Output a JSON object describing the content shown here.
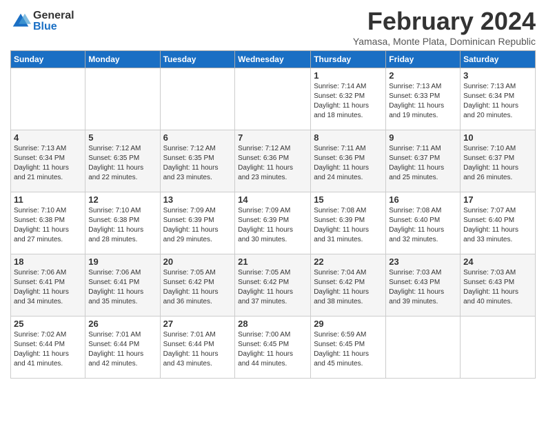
{
  "logo": {
    "general": "General",
    "blue": "Blue"
  },
  "title": "February 2024",
  "location": "Yamasa, Monte Plata, Dominican Republic",
  "days_header": [
    "Sunday",
    "Monday",
    "Tuesday",
    "Wednesday",
    "Thursday",
    "Friday",
    "Saturday"
  ],
  "weeks": [
    [
      {
        "day": "",
        "info": ""
      },
      {
        "day": "",
        "info": ""
      },
      {
        "day": "",
        "info": ""
      },
      {
        "day": "",
        "info": ""
      },
      {
        "day": "1",
        "info": "Sunrise: 7:14 AM\nSunset: 6:32 PM\nDaylight: 11 hours\nand 18 minutes."
      },
      {
        "day": "2",
        "info": "Sunrise: 7:13 AM\nSunset: 6:33 PM\nDaylight: 11 hours\nand 19 minutes."
      },
      {
        "day": "3",
        "info": "Sunrise: 7:13 AM\nSunset: 6:34 PM\nDaylight: 11 hours\nand 20 minutes."
      }
    ],
    [
      {
        "day": "4",
        "info": "Sunrise: 7:13 AM\nSunset: 6:34 PM\nDaylight: 11 hours\nand 21 minutes."
      },
      {
        "day": "5",
        "info": "Sunrise: 7:12 AM\nSunset: 6:35 PM\nDaylight: 11 hours\nand 22 minutes."
      },
      {
        "day": "6",
        "info": "Sunrise: 7:12 AM\nSunset: 6:35 PM\nDaylight: 11 hours\nand 23 minutes."
      },
      {
        "day": "7",
        "info": "Sunrise: 7:12 AM\nSunset: 6:36 PM\nDaylight: 11 hours\nand 23 minutes."
      },
      {
        "day": "8",
        "info": "Sunrise: 7:11 AM\nSunset: 6:36 PM\nDaylight: 11 hours\nand 24 minutes."
      },
      {
        "day": "9",
        "info": "Sunrise: 7:11 AM\nSunset: 6:37 PM\nDaylight: 11 hours\nand 25 minutes."
      },
      {
        "day": "10",
        "info": "Sunrise: 7:10 AM\nSunset: 6:37 PM\nDaylight: 11 hours\nand 26 minutes."
      }
    ],
    [
      {
        "day": "11",
        "info": "Sunrise: 7:10 AM\nSunset: 6:38 PM\nDaylight: 11 hours\nand 27 minutes."
      },
      {
        "day": "12",
        "info": "Sunrise: 7:10 AM\nSunset: 6:38 PM\nDaylight: 11 hours\nand 28 minutes."
      },
      {
        "day": "13",
        "info": "Sunrise: 7:09 AM\nSunset: 6:39 PM\nDaylight: 11 hours\nand 29 minutes."
      },
      {
        "day": "14",
        "info": "Sunrise: 7:09 AM\nSunset: 6:39 PM\nDaylight: 11 hours\nand 30 minutes."
      },
      {
        "day": "15",
        "info": "Sunrise: 7:08 AM\nSunset: 6:39 PM\nDaylight: 11 hours\nand 31 minutes."
      },
      {
        "day": "16",
        "info": "Sunrise: 7:08 AM\nSunset: 6:40 PM\nDaylight: 11 hours\nand 32 minutes."
      },
      {
        "day": "17",
        "info": "Sunrise: 7:07 AM\nSunset: 6:40 PM\nDaylight: 11 hours\nand 33 minutes."
      }
    ],
    [
      {
        "day": "18",
        "info": "Sunrise: 7:06 AM\nSunset: 6:41 PM\nDaylight: 11 hours\nand 34 minutes."
      },
      {
        "day": "19",
        "info": "Sunrise: 7:06 AM\nSunset: 6:41 PM\nDaylight: 11 hours\nand 35 minutes."
      },
      {
        "day": "20",
        "info": "Sunrise: 7:05 AM\nSunset: 6:42 PM\nDaylight: 11 hours\nand 36 minutes."
      },
      {
        "day": "21",
        "info": "Sunrise: 7:05 AM\nSunset: 6:42 PM\nDaylight: 11 hours\nand 37 minutes."
      },
      {
        "day": "22",
        "info": "Sunrise: 7:04 AM\nSunset: 6:42 PM\nDaylight: 11 hours\nand 38 minutes."
      },
      {
        "day": "23",
        "info": "Sunrise: 7:03 AM\nSunset: 6:43 PM\nDaylight: 11 hours\nand 39 minutes."
      },
      {
        "day": "24",
        "info": "Sunrise: 7:03 AM\nSunset: 6:43 PM\nDaylight: 11 hours\nand 40 minutes."
      }
    ],
    [
      {
        "day": "25",
        "info": "Sunrise: 7:02 AM\nSunset: 6:44 PM\nDaylight: 11 hours\nand 41 minutes."
      },
      {
        "day": "26",
        "info": "Sunrise: 7:01 AM\nSunset: 6:44 PM\nDaylight: 11 hours\nand 42 minutes."
      },
      {
        "day": "27",
        "info": "Sunrise: 7:01 AM\nSunset: 6:44 PM\nDaylight: 11 hours\nand 43 minutes."
      },
      {
        "day": "28",
        "info": "Sunrise: 7:00 AM\nSunset: 6:45 PM\nDaylight: 11 hours\nand 44 minutes."
      },
      {
        "day": "29",
        "info": "Sunrise: 6:59 AM\nSunset: 6:45 PM\nDaylight: 11 hours\nand 45 minutes."
      },
      {
        "day": "",
        "info": ""
      },
      {
        "day": "",
        "info": ""
      }
    ]
  ]
}
